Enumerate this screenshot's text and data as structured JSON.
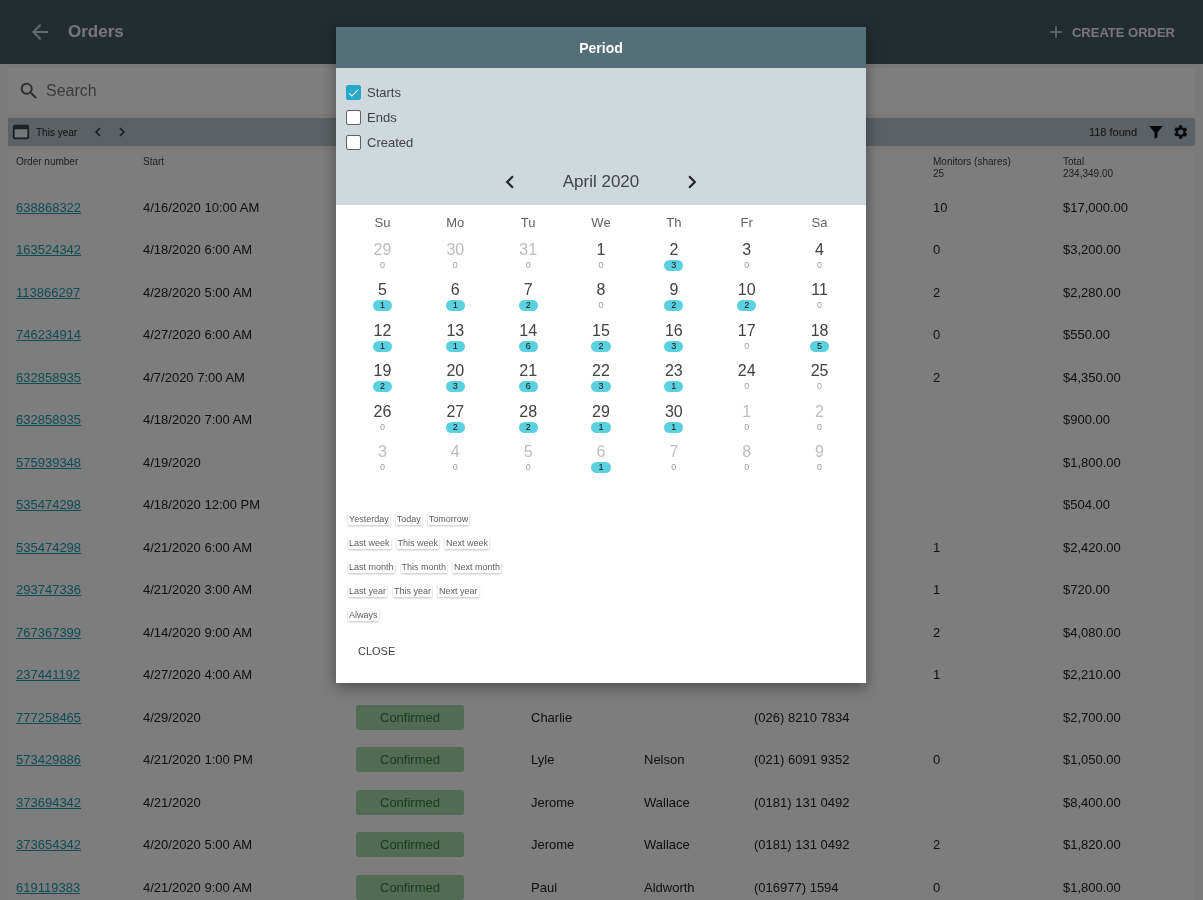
{
  "app_bar": {
    "title": "Orders",
    "action": "CREATE ORDER"
  },
  "search": {
    "placeholder": "Search"
  },
  "toolbar": {
    "period": "This year",
    "found": "118 found"
  },
  "table": {
    "columns": [
      {
        "label": "Order number"
      },
      {
        "label": "Start"
      },
      {
        "label": "Monitors (shares)",
        "sub": "25"
      },
      {
        "label": "Total",
        "sub": "234,349.00"
      }
    ],
    "rows": [
      {
        "order": "638868322",
        "start": "4/16/2020 10:00 AM",
        "monitors": "10",
        "total": "$17,000.00"
      },
      {
        "order": "163524342",
        "start": "4/18/2020 6:00 AM",
        "monitors": "0",
        "total": "$3,200.00"
      },
      {
        "order": "113866297",
        "start": "4/28/2020 5:00 AM",
        "monitors": "2",
        "total": "$2,280.00"
      },
      {
        "order": "746234914",
        "start": "4/27/2020 6:00 AM",
        "monitors": "0",
        "total": "$550.00"
      },
      {
        "order": "632858935",
        "start": "4/7/2020 7:00 AM",
        "monitors": "2",
        "total": "$4,350.00"
      },
      {
        "order": "632858935",
        "start": "4/18/2020 7:00 AM",
        "total": "$900.00"
      },
      {
        "order": "575939348",
        "start": "4/19/2020",
        "total": "$1,800.00"
      },
      {
        "order": "535474298",
        "start": "4/18/2020 12:00 PM",
        "total": "$504.00"
      },
      {
        "order": "535474298",
        "start": "4/21/2020 6:00 AM",
        "monitors": "1",
        "total": "$2,420.00"
      },
      {
        "order": "293747336",
        "start": "4/21/2020 3:00 AM",
        "monitors": "1",
        "total": "$720.00"
      },
      {
        "order": "767367399",
        "start": "4/14/2020 9:00 AM",
        "monitors": "2",
        "total": "$4,080.00"
      },
      {
        "order": "237441192",
        "start": "4/27/2020 4:00 AM",
        "monitors": "1",
        "total": "$2,210.00"
      },
      {
        "order": "777258465",
        "start": "4/29/2020",
        "status": "Confirmed",
        "first": "Charlie",
        "phone": "(026) 8210 7834",
        "total": "$2,700.00"
      },
      {
        "order": "573429886",
        "start": "4/21/2020 1:00 PM",
        "status": "Confirmed",
        "first": "Lyle",
        "last": "Nelson",
        "phone": "(021) 6091 9352",
        "monitors": "0",
        "total": "$1,050.00"
      },
      {
        "order": "373694342",
        "start": "4/21/2020",
        "status": "Confirmed",
        "first": "Jerome",
        "last": "Wallace",
        "phone": "(0181) 131 0492",
        "total": "$8,400.00"
      },
      {
        "order": "373654342",
        "start": "4/20/2020 5:00 AM",
        "status": "Confirmed",
        "first": "Jerome",
        "last": "Wallace",
        "phone": "(0181) 131 0492",
        "monitors": "2",
        "total": "$1,820.00"
      },
      {
        "order": "619119383",
        "start": "4/21/2020 9:00 AM",
        "status": "Confirmed",
        "first": "Paul",
        "last": "Aldworth",
        "phone": "(016977) 1594",
        "monitors": "0",
        "total": "$1,800.00"
      }
    ]
  },
  "dialog": {
    "title": "Period",
    "filters": [
      {
        "label": "Starts",
        "checked": true
      },
      {
        "label": "Ends",
        "checked": false
      },
      {
        "label": "Created",
        "checked": false
      }
    ],
    "month": "April 2020",
    "weekdays": [
      "Su",
      "Mo",
      "Tu",
      "We",
      "Th",
      "Fr",
      "Sa"
    ],
    "weeks": [
      [
        {
          "day": "29",
          "count": "0",
          "outside": true,
          "has_orders": false
        },
        {
          "day": "30",
          "count": "0",
          "outside": true,
          "has_orders": false
        },
        {
          "day": "31",
          "count": "0",
          "outside": true,
          "has_orders": false
        },
        {
          "day": "1",
          "count": "0",
          "outside": false,
          "has_orders": false
        },
        {
          "day": "2",
          "count": "3",
          "outside": false,
          "has_orders": true
        },
        {
          "day": "3",
          "count": "0",
          "outside": false,
          "has_orders": false
        },
        {
          "day": "4",
          "count": "0",
          "outside": false,
          "has_orders": false
        }
      ],
      [
        {
          "day": "5",
          "count": "1",
          "outside": false,
          "has_orders": true
        },
        {
          "day": "6",
          "count": "1",
          "outside": false,
          "has_orders": true
        },
        {
          "day": "7",
          "count": "2",
          "outside": false,
          "has_orders": true
        },
        {
          "day": "8",
          "count": "0",
          "outside": false,
          "has_orders": false
        },
        {
          "day": "9",
          "count": "2",
          "outside": false,
          "has_orders": true
        },
        {
          "day": "10",
          "count": "2",
          "outside": false,
          "has_orders": true
        },
        {
          "day": "11",
          "count": "0",
          "outside": false,
          "has_orders": false
        }
      ],
      [
        {
          "day": "12",
          "count": "1",
          "outside": false,
          "has_orders": true
        },
        {
          "day": "13",
          "count": "1",
          "outside": false,
          "has_orders": true
        },
        {
          "day": "14",
          "count": "6",
          "outside": false,
          "has_orders": true
        },
        {
          "day": "15",
          "count": "2",
          "outside": false,
          "has_orders": true
        },
        {
          "day": "16",
          "count": "3",
          "outside": false,
          "has_orders": true
        },
        {
          "day": "17",
          "count": "0",
          "outside": false,
          "has_orders": false
        },
        {
          "day": "18",
          "count": "5",
          "outside": false,
          "has_orders": true
        }
      ],
      [
        {
          "day": "19",
          "count": "2",
          "outside": false,
          "has_orders": true
        },
        {
          "day": "20",
          "count": "3",
          "outside": false,
          "has_orders": true
        },
        {
          "day": "21",
          "count": "6",
          "outside": false,
          "has_orders": true
        },
        {
          "day": "22",
          "count": "3",
          "outside": false,
          "has_orders": true
        },
        {
          "day": "23",
          "count": "1",
          "outside": false,
          "has_orders": true
        },
        {
          "day": "24",
          "count": "0",
          "outside": false,
          "has_orders": false
        },
        {
          "day": "25",
          "count": "0",
          "outside": false,
          "has_orders": false
        }
      ],
      [
        {
          "day": "26",
          "count": "0",
          "outside": false,
          "has_orders": false
        },
        {
          "day": "27",
          "count": "2",
          "outside": false,
          "has_orders": true
        },
        {
          "day": "28",
          "count": "2",
          "outside": false,
          "has_orders": true
        },
        {
          "day": "29",
          "count": "1",
          "outside": false,
          "has_orders": true
        },
        {
          "day": "30",
          "count": "1",
          "outside": false,
          "has_orders": true
        },
        {
          "day": "1",
          "count": "0",
          "outside": true,
          "has_orders": false
        },
        {
          "day": "2",
          "count": "0",
          "outside": true,
          "has_orders": false
        }
      ],
      [
        {
          "day": "3",
          "count": "0",
          "outside": true,
          "has_orders": false
        },
        {
          "day": "4",
          "count": "0",
          "outside": true,
          "has_orders": false
        },
        {
          "day": "5",
          "count": "0",
          "outside": true,
          "has_orders": false
        },
        {
          "day": "6",
          "count": "1",
          "outside": true,
          "has_orders": true
        },
        {
          "day": "7",
          "count": "0",
          "outside": true,
          "has_orders": false
        },
        {
          "day": "8",
          "count": "0",
          "outside": true,
          "has_orders": false
        },
        {
          "day": "9",
          "count": "0",
          "outside": true,
          "has_orders": false
        }
      ]
    ],
    "shortcuts": [
      [
        "Yesterday",
        "Today",
        "Tomorrow"
      ],
      [
        "Last week",
        "This week",
        "Next week"
      ],
      [
        "Last month",
        "This month",
        "Next month"
      ],
      [
        "Last year",
        "This year",
        "Next year"
      ],
      [
        "Always"
      ]
    ],
    "close": "CLOSE"
  }
}
